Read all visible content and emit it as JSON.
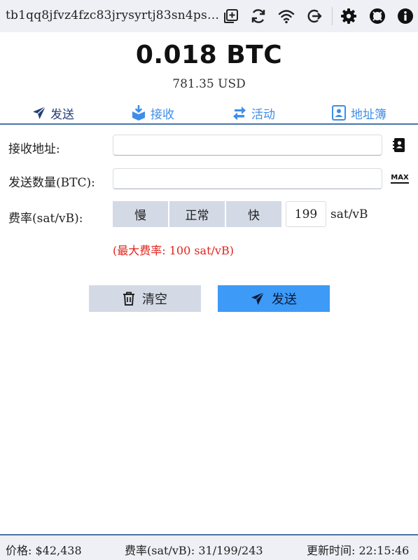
{
  "topbar": {
    "address": "tb1qq8jfvz4fzc83jrysyrtj83sn4ps0...",
    "icons": [
      "add-account-icon",
      "refresh-icon",
      "wifi-icon",
      "logout-icon",
      "settings-icon",
      "help-icon",
      "info-icon"
    ]
  },
  "balance": {
    "btc": "0.018 BTC",
    "usd": "781.35 USD"
  },
  "tabs": [
    {
      "label": "发送",
      "icon": "send-icon",
      "active": true
    },
    {
      "label": "接收",
      "icon": "receive-icon",
      "active": false
    },
    {
      "label": "活动",
      "icon": "activity-icon",
      "active": false
    },
    {
      "label": "地址簿",
      "icon": "address-book-icon",
      "active": false
    }
  ],
  "form": {
    "address_label": "接收地址:",
    "address_value": "",
    "amount_label": "发送数量(BTC):",
    "amount_value": "",
    "max_label": "MAX",
    "fee_label": "费率(sat/vB):",
    "fee_options": [
      "慢",
      "正常",
      "快"
    ],
    "fee_value": "199",
    "fee_unit": "sat/vB",
    "max_fee_note": "(最大费率: 100 sat/vB)"
  },
  "actions": {
    "clear_label": "清空",
    "send_label": "发送"
  },
  "status": {
    "price": "价格: $42,438",
    "fees": "费率(sat/vB): 31/199/243",
    "updated": "更新时间: 22:15:46"
  },
  "colors": {
    "accent_dark": "#243f7a",
    "accent_light": "#3d8ee8",
    "send_button": "#3d9af7",
    "neutral_button": "#d3dae5",
    "warning_text": "#e0241c",
    "bar_background": "#eef0f5"
  }
}
